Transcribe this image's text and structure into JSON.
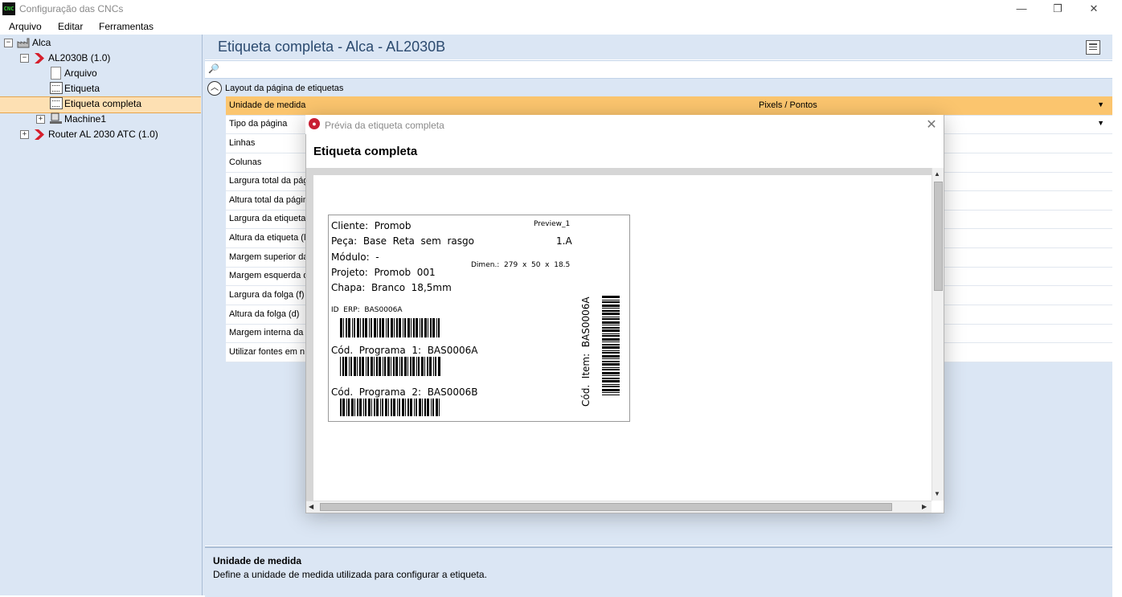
{
  "window": {
    "title": "Configuração das CNCs",
    "icon_text": "CNC",
    "controls": {
      "minimize": "—",
      "maximize": "❐",
      "close": "✕"
    }
  },
  "menu": [
    "Arquivo",
    "Editar",
    "Ferramentas"
  ],
  "tree": {
    "root": {
      "label": "Alca",
      "expander": "−"
    },
    "machine": {
      "label": "AL2030B (1.0)",
      "expander": "−"
    },
    "children": [
      "Arquivo",
      "Etiqueta",
      "Etiqueta completa"
    ],
    "machine1": {
      "label": "Machine1",
      "expander": "+"
    },
    "router": {
      "label": "Router AL 2030 ATC (1.0)",
      "expander": "+"
    },
    "selected": "Etiqueta completa"
  },
  "panel": {
    "title": "Etiqueta completa - Alca - AL2030B",
    "group": "Layout da página de etiquetas",
    "properties": [
      {
        "name": "Unidade de medida",
        "value": "Pixels / Pontos",
        "dropdown": true
      },
      {
        "name": "Tipo da página",
        "value": "",
        "dropdown": true
      },
      {
        "name": "Linhas",
        "value": ""
      },
      {
        "name": "Colunas",
        "value": ""
      },
      {
        "name": "Largura total da pág",
        "value": ""
      },
      {
        "name": "Altura total da págin",
        "value": ""
      },
      {
        "name": "Largura da etiqueta",
        "value": ""
      },
      {
        "name": "Altura da etiqueta (l",
        "value": ""
      },
      {
        "name": "Margem superior da",
        "value": ""
      },
      {
        "name": "Margem esquerda d",
        "value": ""
      },
      {
        "name": "Largura da folga (f)",
        "value": ""
      },
      {
        "name": "Altura da folga (d)",
        "value": ""
      },
      {
        "name": "Margem interna da",
        "value": ""
      },
      {
        "name": "Utilizar fontes em n",
        "value": ""
      }
    ],
    "description": {
      "title": "Unidade de medida",
      "text": "Define a unidade de medida utilizada para configurar a etiqueta."
    }
  },
  "dialog": {
    "title": "Prévia da etiqueta completa",
    "heading": "Etiqueta completa",
    "label": {
      "cliente": "Cliente:  Promob",
      "preview": "Preview_1",
      "peca": "Peça:  Base  Reta  sem  rasgo",
      "peca_num": "1.A",
      "modulo": "Módulo:  -",
      "dimen": "Dimen.:  279  x  50  x  18.5",
      "projeto": "Projeto:  Promob  001",
      "chapa": "Chapa:  Branco  18,5mm",
      "id_erp": "ID  ERP:  BAS0006A",
      "cod1": "Cód.  Programa  1:  BAS0006A",
      "cod2": "Cód.  Programa  2:  BAS0006B",
      "cod_item": "Cód.  Item:  BAS0006A"
    }
  }
}
